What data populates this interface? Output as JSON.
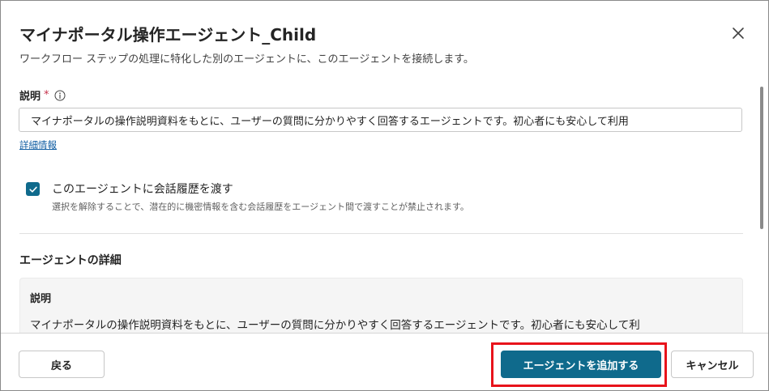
{
  "dialog": {
    "title": "マイナポータル操作エージェント_Child",
    "subtitle": "ワークフロー ステップの処理に特化した別のエージェントに、このエージェントを接続します。",
    "close_icon": "close-icon"
  },
  "description_field": {
    "label": "説明",
    "required_mark": "*",
    "info_icon": "info-icon",
    "value": "マイナポータルの操作説明資料をもとに、ユーザーの質問に分かりやすく回答するエージェントです。初心者にも安心して利用"
  },
  "more_info_link": "詳細情報",
  "history_checkbox": {
    "checked": true,
    "label": "このエージェントに会話履歴を渡す",
    "hint": "選択を解除することで、潜在的に機密情報を含む会話履歴をエージェント間で渡すことが禁止されます。"
  },
  "agent_details": {
    "section_title": "エージェントの詳細",
    "description_label": "説明",
    "description_text": "マイナポータルの操作説明資料をもとに、ユーザーの質問に分かりやすく回答するエージェントです。初心者にも安心して利"
  },
  "footer": {
    "back_label": "戻る",
    "add_label": "エージェントを追加する",
    "cancel_label": "キャンセル"
  },
  "colors": {
    "primary": "#0f6a8c",
    "highlight": "#e8131b",
    "required": "#c4314b",
    "link": "#115ea3"
  }
}
